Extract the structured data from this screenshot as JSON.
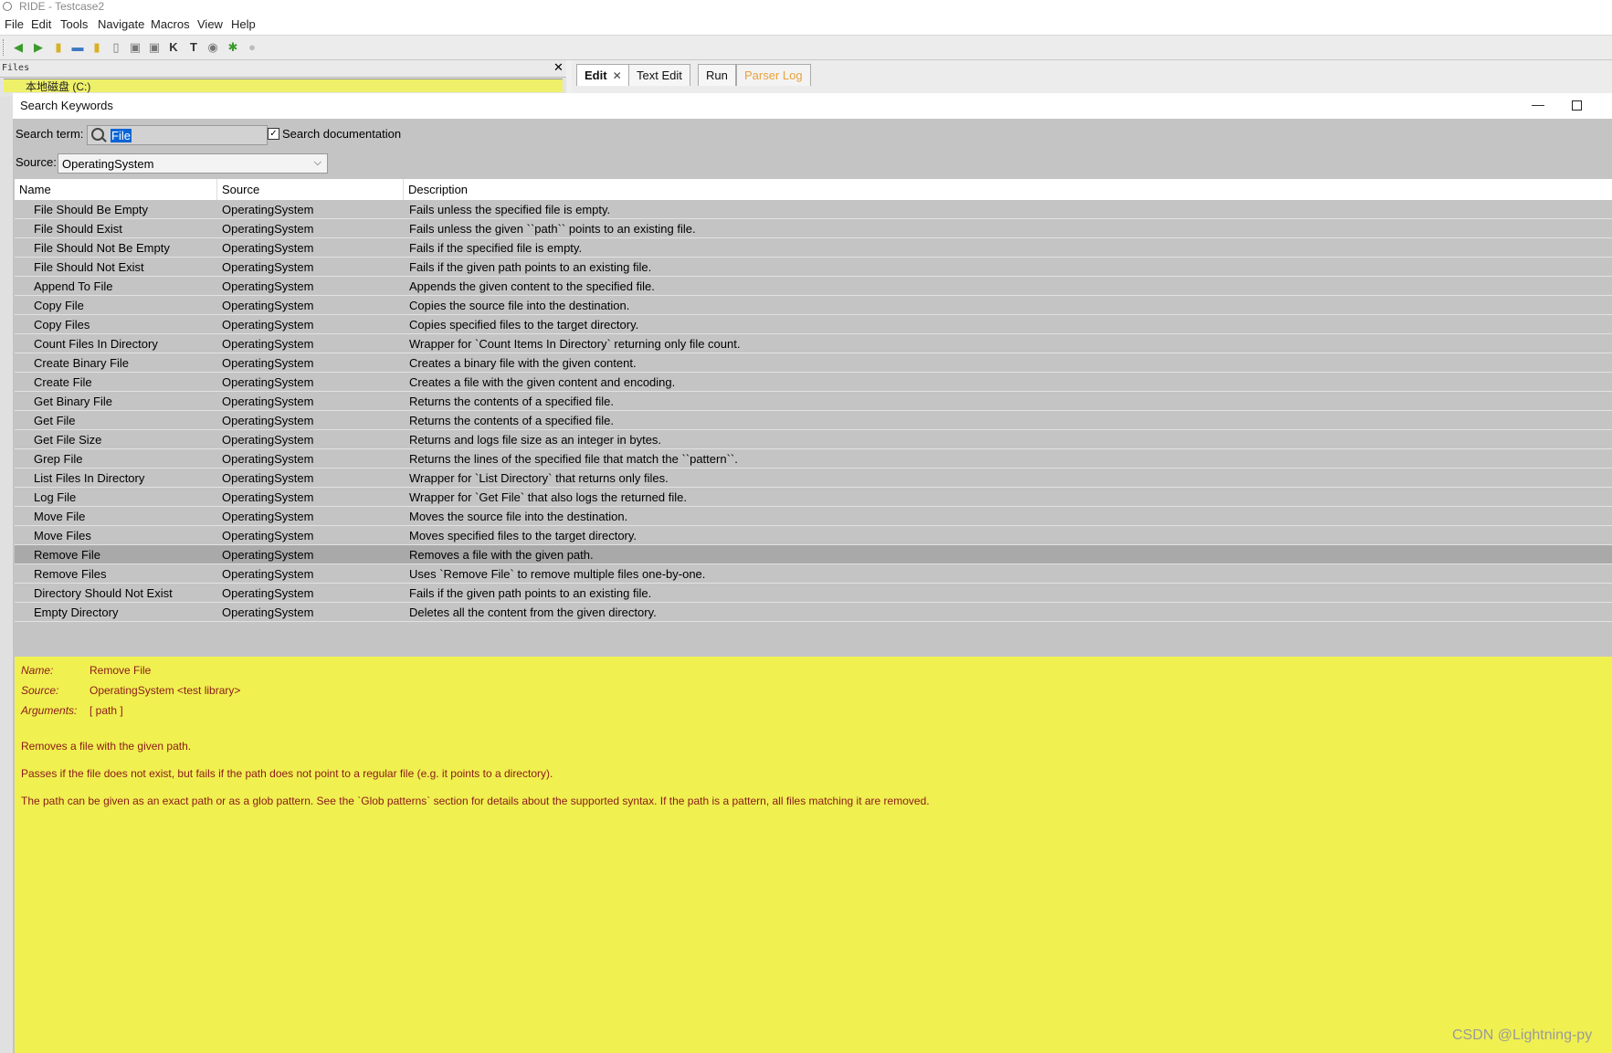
{
  "window": {
    "title": "RIDE - Testcase2"
  },
  "menu": [
    "File",
    "Edit",
    "Tools",
    "Navigate",
    "Macros",
    "View",
    "Help"
  ],
  "files_panel": {
    "label": "Files",
    "drive": "本地磁盘 (C:)"
  },
  "tabs": [
    {
      "label": "Edit"
    },
    {
      "label": "Text Edit"
    },
    {
      "label": "Run"
    },
    {
      "label": "Parser Log"
    }
  ],
  "dialog": {
    "title": "Search Keywords",
    "search_label": "Search term:",
    "search_value": "File",
    "search_doc_label": "Search documentation",
    "search_doc_checked": "✓",
    "source_label": "Source:",
    "source_value": "OperatingSystem"
  },
  "columns": [
    "Name",
    "Source",
    "Description"
  ],
  "rows": [
    {
      "name": "File Should Be Empty",
      "source": "OperatingSystem",
      "desc": "Fails unless the specified file is empty."
    },
    {
      "name": "File Should Exist",
      "source": "OperatingSystem",
      "desc": "Fails unless the given ``path`` points to an existing file."
    },
    {
      "name": "File Should Not Be Empty",
      "source": "OperatingSystem",
      "desc": "Fails if the specified file is empty."
    },
    {
      "name": "File Should Not Exist",
      "source": "OperatingSystem",
      "desc": "Fails if the given path points to an existing file."
    },
    {
      "name": "Append To File",
      "source": "OperatingSystem",
      "desc": "Appends the given content to the specified file."
    },
    {
      "name": "Copy File",
      "source": "OperatingSystem",
      "desc": "Copies the source file into the destination."
    },
    {
      "name": "Copy Files",
      "source": "OperatingSystem",
      "desc": "Copies specified files to the target directory."
    },
    {
      "name": "Count Files In Directory",
      "source": "OperatingSystem",
      "desc": "Wrapper for `Count Items In Directory` returning only file count."
    },
    {
      "name": "Create Binary File",
      "source": "OperatingSystem",
      "desc": "Creates a binary file with the given content."
    },
    {
      "name": "Create File",
      "source": "OperatingSystem",
      "desc": "Creates a file with the given content and encoding."
    },
    {
      "name": "Get Binary File",
      "source": "OperatingSystem",
      "desc": "Returns the contents of a specified file."
    },
    {
      "name": "Get File",
      "source": "OperatingSystem",
      "desc": "Returns the contents of a specified file."
    },
    {
      "name": "Get File Size",
      "source": "OperatingSystem",
      "desc": "Returns and logs file size as an integer in bytes."
    },
    {
      "name": "Grep File",
      "source": "OperatingSystem",
      "desc": "Returns the lines of the specified file that match the ``pattern``."
    },
    {
      "name": "List Files In Directory",
      "source": "OperatingSystem",
      "desc": "Wrapper for `List Directory` that returns only files."
    },
    {
      "name": "Log File",
      "source": "OperatingSystem",
      "desc": "Wrapper for `Get File` that also logs the returned file."
    },
    {
      "name": "Move File",
      "source": "OperatingSystem",
      "desc": "Moves the source file into the destination."
    },
    {
      "name": "Move Files",
      "source": "OperatingSystem",
      "desc": "Moves specified files to the target directory."
    },
    {
      "name": "Remove File",
      "source": "OperatingSystem",
      "desc": "Removes a file with the given path.",
      "selected": true
    },
    {
      "name": "Remove Files",
      "source": "OperatingSystem",
      "desc": "Uses `Remove File` to remove multiple files one-by-one."
    },
    {
      "name": "Directory Should Not Exist",
      "source": "OperatingSystem",
      "desc": "Fails if the given path points to an existing file."
    },
    {
      "name": "Empty Directory",
      "source": "OperatingSystem",
      "desc": "Deletes all the content from the given directory."
    }
  ],
  "detail": {
    "name_key": "Name:",
    "name_val": "Remove File",
    "source_key": "Source:",
    "source_val": "OperatingSystem <test library>",
    "args_key": "Arguments:",
    "args_val": "[ path ]",
    "para1": "Removes a file with the given path.",
    "para2": "Passes if the file does not exist, but fails if the path does not point to a regular file (e.g. it points to a directory).",
    "para3": "The path can be given as an exact path or as a glob pattern. See the `Glob patterns` section for details about the supported syntax. If the path is a pattern, all files matching it are removed."
  },
  "watermark": "CSDN @Lightning-py"
}
